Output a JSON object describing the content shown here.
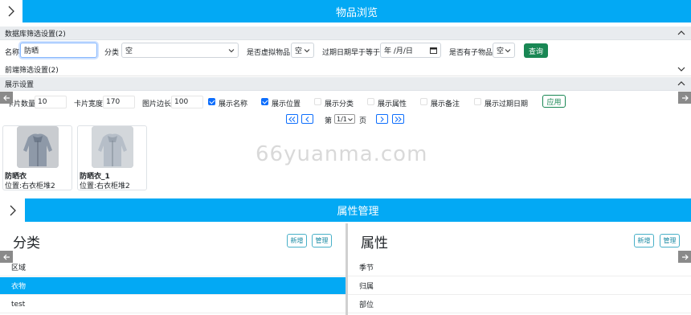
{
  "browse": {
    "title": "物品浏览"
  },
  "db_filter": {
    "header": "数据库筛选设置(2)",
    "name_label": "名称",
    "name_value": "防晒",
    "category_label": "分类",
    "category_value": "空",
    "virtual_label": "是否虚拟物品",
    "virtual_value": "空",
    "expire_label": "过期日期早于等于",
    "expire_placeholder": "年 /月/日",
    "has_child_label": "是否有子物品",
    "has_child_value": "空",
    "query_button": "查询"
  },
  "frontend_filter": {
    "header": "前端筛选设置(2)"
  },
  "display": {
    "header": "展示设置",
    "card_count_label": "卡片数量",
    "card_count_value": "10",
    "card_width_label": "卡片宽度",
    "card_width_value": "170",
    "img_side_label": "图片边长",
    "img_side_value": "100",
    "options": [
      {
        "label": "展示名称",
        "checked": true
      },
      {
        "label": "展示位置",
        "checked": true
      },
      {
        "label": "展示分类",
        "checked": false
      },
      {
        "label": "展示属性",
        "checked": false
      },
      {
        "label": "展示备注",
        "checked": false
      },
      {
        "label": "展示过期日期",
        "checked": false
      }
    ],
    "apply_button": "应用"
  },
  "pager": {
    "page_prefix": "第",
    "page_value": "1/1",
    "page_suffix": "页"
  },
  "cards": [
    {
      "name": "防晒衣",
      "location": "位置:右衣柜堆2"
    },
    {
      "name": "防晒衣_1",
      "location": "位置:右衣柜堆2"
    }
  ],
  "watermark": "66yuanma.com",
  "attr_mgmt": {
    "title": "属性管理",
    "category_panel": {
      "title": "分类",
      "add_button": "新增",
      "manage_button": "管理",
      "items": [
        "区域",
        "衣物",
        "test"
      ],
      "active_index": 1
    },
    "attribute_panel": {
      "title": "属性",
      "add_button": "新增",
      "manage_button": "管理",
      "items": [
        "季节",
        "归属",
        "部位"
      ]
    }
  },
  "colors": {
    "accent": "#03a9f4",
    "success": "#198754",
    "primary": "#0d6efd"
  }
}
